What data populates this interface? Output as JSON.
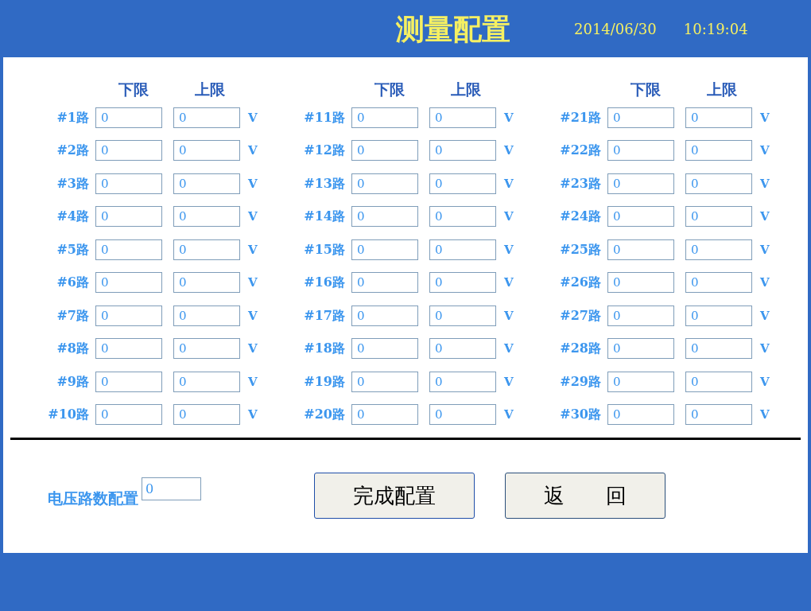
{
  "header": {
    "title": "测量配置",
    "date": "2014/06/30",
    "time": "10:19:04"
  },
  "columns": [
    {
      "headers": [
        "下限",
        "上限"
      ],
      "rows": [
        {
          "label": "#1路",
          "low": "0",
          "high": "0",
          "unit": "V"
        },
        {
          "label": "#2路",
          "low": "0",
          "high": "0",
          "unit": "V"
        },
        {
          "label": "#3路",
          "low": "0",
          "high": "0",
          "unit": "V"
        },
        {
          "label": "#4路",
          "low": "0",
          "high": "0",
          "unit": "V"
        },
        {
          "label": "#5路",
          "low": "0",
          "high": "0",
          "unit": "V"
        },
        {
          "label": "#6路",
          "low": "0",
          "high": "0",
          "unit": "V"
        },
        {
          "label": "#7路",
          "low": "0",
          "high": "0",
          "unit": "V"
        },
        {
          "label": "#8路",
          "low": "0",
          "high": "0",
          "unit": "V"
        },
        {
          "label": "#9路",
          "low": "0",
          "high": "0",
          "unit": "V"
        },
        {
          "label": "#10路",
          "low": "0",
          "high": "0",
          "unit": "V"
        }
      ]
    },
    {
      "headers": [
        "下限",
        "上限"
      ],
      "rows": [
        {
          "label": "#11路",
          "low": "0",
          "high": "0",
          "unit": "V"
        },
        {
          "label": "#12路",
          "low": "0",
          "high": "0",
          "unit": "V"
        },
        {
          "label": "#13路",
          "low": "0",
          "high": "0",
          "unit": "V"
        },
        {
          "label": "#14路",
          "low": "0",
          "high": "0",
          "unit": "V"
        },
        {
          "label": "#15路",
          "low": "0",
          "high": "0",
          "unit": "V"
        },
        {
          "label": "#16路",
          "low": "0",
          "high": "0",
          "unit": "V"
        },
        {
          "label": "#17路",
          "low": "0",
          "high": "0",
          "unit": "V"
        },
        {
          "label": "#18路",
          "low": "0",
          "high": "0",
          "unit": "V"
        },
        {
          "label": "#19路",
          "low": "0",
          "high": "0",
          "unit": "V"
        },
        {
          "label": "#20路",
          "low": "0",
          "high": "0",
          "unit": "V"
        }
      ]
    },
    {
      "headers": [
        "下限",
        "上限"
      ],
      "rows": [
        {
          "label": "#21路",
          "low": "0",
          "high": "0",
          "unit": "V"
        },
        {
          "label": "#22路",
          "low": "0",
          "high": "0",
          "unit": "V"
        },
        {
          "label": "#23路",
          "low": "0",
          "high": "0",
          "unit": "V"
        },
        {
          "label": "#24路",
          "low": "0",
          "high": "0",
          "unit": "V"
        },
        {
          "label": "#25路",
          "low": "0",
          "high": "0",
          "unit": "V"
        },
        {
          "label": "#26路",
          "low": "0",
          "high": "0",
          "unit": "V"
        },
        {
          "label": "#27路",
          "low": "0",
          "high": "0",
          "unit": "V"
        },
        {
          "label": "#28路",
          "low": "0",
          "high": "0",
          "unit": "V"
        },
        {
          "label": "#29路",
          "low": "0",
          "high": "0",
          "unit": "V"
        },
        {
          "label": "#30路",
          "low": "0",
          "high": "0",
          "unit": "V"
        }
      ]
    }
  ],
  "channel_count": {
    "label": "电压路数配置",
    "value": "0"
  },
  "buttons": [
    "完成配置",
    "返　　回"
  ]
}
